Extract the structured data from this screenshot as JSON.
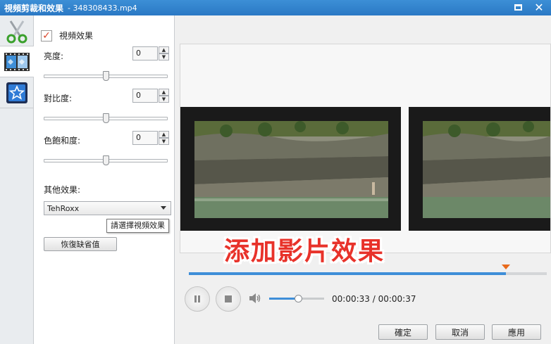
{
  "window": {
    "title": "視頻剪裁和效果",
    "filename": " - 348308433.mp4",
    "maximize_label": "",
    "close_label": "✕"
  },
  "left_tabs": [
    {
      "name": "trim",
      "icon": "scissors-icon"
    },
    {
      "name": "effects",
      "icon": "film-effect-icon"
    },
    {
      "name": "watermark",
      "icon": "star-icon"
    }
  ],
  "panel": {
    "video_effect_label": "視頻效果",
    "video_effect_checked": true,
    "brightness": {
      "label": "亮度:",
      "value": "0",
      "slider_fraction": 0.5
    },
    "contrast": {
      "label": "對比度:",
      "value": "0",
      "slider_fraction": 0.5
    },
    "saturation": {
      "label": "色飽和度:",
      "value": "0",
      "slider_fraction": 0.5
    },
    "other_effects_label": "其他效果:",
    "other_effects_selected": "TehRoxx",
    "tooltip": "請選擇視頻效果",
    "reset_label": "恢復缺省值"
  },
  "preview": {
    "overlay_caption": "添加影片效果",
    "progress_fraction": 0.885,
    "volume_fraction": 0.52,
    "time_current": "00:00:33",
    "time_separator": " / ",
    "time_total": "00:00:37"
  },
  "footer": {
    "ok_label": "確定",
    "cancel_label": "取消",
    "apply_label": "應用"
  },
  "colors": {
    "titlebar": "#2a78c4",
    "accent_blue": "#3e8ed8",
    "overlay_red": "#e8322a",
    "marker_orange": "#e86a1c",
    "check_red": "#d9452b"
  }
}
